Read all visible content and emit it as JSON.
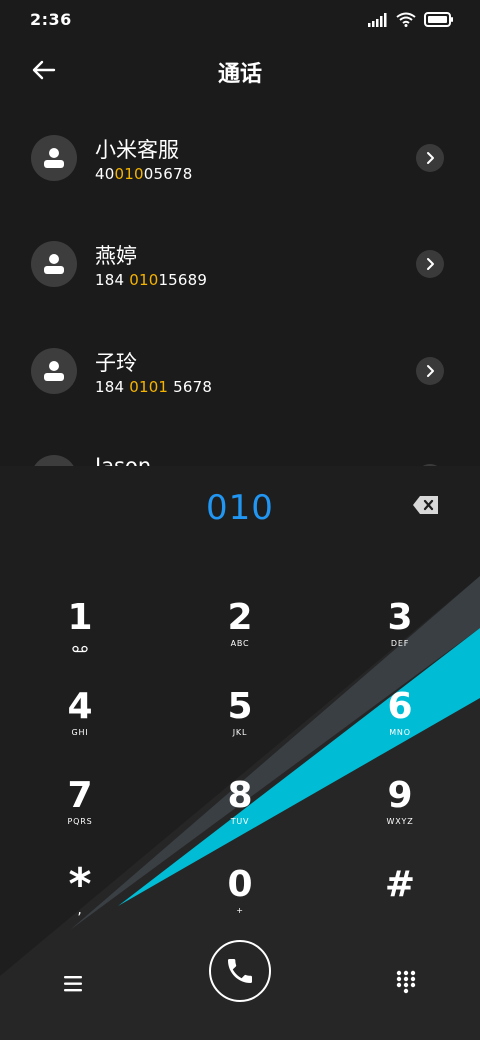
{
  "status_bar": {
    "time": "2:36",
    "icons": [
      "signal-icon",
      "wifi-icon",
      "battery-icon"
    ]
  },
  "header": {
    "title": "通话",
    "back_icon": "arrow-left-icon"
  },
  "contacts": [
    {
      "name": "小米客服",
      "number_parts": [
        "40",
        "010",
        "05678"
      ]
    },
    {
      "name": "燕婷",
      "number_parts": [
        "184 ",
        "010",
        "15689"
      ]
    },
    {
      "name": "子玲",
      "number_parts": [
        "184 ",
        "0101",
        " 5678"
      ]
    },
    {
      "name": "Jason",
      "number_parts": [
        "",
        "",
        ""
      ]
    }
  ],
  "dialer": {
    "input": "010",
    "keys": [
      {
        "digit": "1",
        "letters": ""
      },
      {
        "digit": "2",
        "letters": "ABC"
      },
      {
        "digit": "3",
        "letters": "DEF"
      },
      {
        "digit": "4",
        "letters": "GHI"
      },
      {
        "digit": "5",
        "letters": "JKL"
      },
      {
        "digit": "6",
        "letters": "MNO"
      },
      {
        "digit": "7",
        "letters": "PQRS"
      },
      {
        "digit": "8",
        "letters": "TUV"
      },
      {
        "digit": "9",
        "letters": "WXYZ"
      },
      {
        "digit": "*",
        "letters": ","
      },
      {
        "digit": "0",
        "letters": "+"
      },
      {
        "digit": "#",
        "letters": ""
      }
    ],
    "accent_color": "#00bcd4",
    "highlight_color": "#f5b400",
    "input_color": "#2196f3"
  }
}
